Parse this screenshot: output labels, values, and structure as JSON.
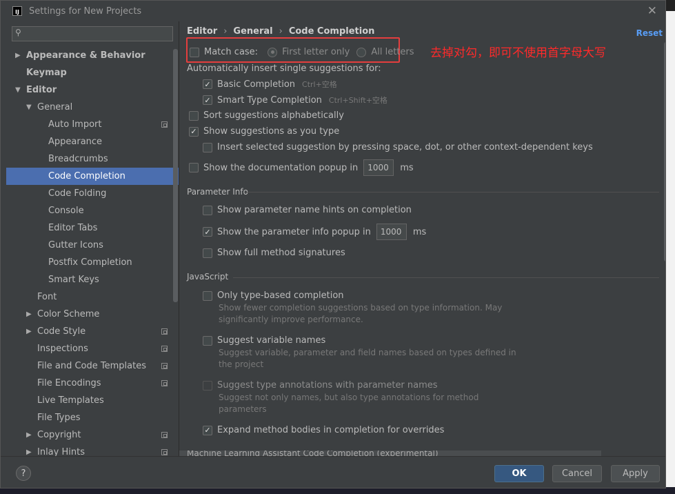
{
  "window": {
    "title": "Settings for New Projects",
    "logo_text": "IJ"
  },
  "search": {
    "placeholder": ""
  },
  "tree": [
    {
      "label": "Appearance & Behavior",
      "bold": true,
      "arrow": "▶",
      "indent": 0
    },
    {
      "label": "Keymap",
      "bold": true,
      "arrow": "",
      "indent": 0
    },
    {
      "label": "Editor",
      "bold": true,
      "arrow": "▼",
      "indent": 0
    },
    {
      "label": "General",
      "bold": false,
      "arrow": "▼",
      "indent": 1
    },
    {
      "label": "Auto Import",
      "bold": false,
      "arrow": "",
      "indent": 2,
      "copy": true
    },
    {
      "label": "Appearance",
      "bold": false,
      "arrow": "",
      "indent": 2
    },
    {
      "label": "Breadcrumbs",
      "bold": false,
      "arrow": "",
      "indent": 2
    },
    {
      "label": "Code Completion",
      "bold": false,
      "arrow": "",
      "indent": 2,
      "selected": true
    },
    {
      "label": "Code Folding",
      "bold": false,
      "arrow": "",
      "indent": 2
    },
    {
      "label": "Console",
      "bold": false,
      "arrow": "",
      "indent": 2
    },
    {
      "label": "Editor Tabs",
      "bold": false,
      "arrow": "",
      "indent": 2
    },
    {
      "label": "Gutter Icons",
      "bold": false,
      "arrow": "",
      "indent": 2
    },
    {
      "label": "Postfix Completion",
      "bold": false,
      "arrow": "",
      "indent": 2
    },
    {
      "label": "Smart Keys",
      "bold": false,
      "arrow": "",
      "indent": 2
    },
    {
      "label": "Font",
      "bold": false,
      "arrow": "",
      "indent": 1
    },
    {
      "label": "Color Scheme",
      "bold": false,
      "arrow": "▶",
      "indent": 1
    },
    {
      "label": "Code Style",
      "bold": false,
      "arrow": "▶",
      "indent": 1,
      "copy": true
    },
    {
      "label": "Inspections",
      "bold": false,
      "arrow": "",
      "indent": 1,
      "copy": true
    },
    {
      "label": "File and Code Templates",
      "bold": false,
      "arrow": "",
      "indent": 1,
      "copy": true
    },
    {
      "label": "File Encodings",
      "bold": false,
      "arrow": "",
      "indent": 1,
      "copy": true
    },
    {
      "label": "Live Templates",
      "bold": false,
      "arrow": "",
      "indent": 1
    },
    {
      "label": "File Types",
      "bold": false,
      "arrow": "",
      "indent": 1
    },
    {
      "label": "Copyright",
      "bold": false,
      "arrow": "▶",
      "indent": 1,
      "copy": true
    },
    {
      "label": "Inlay Hints",
      "bold": false,
      "arrow": "▶",
      "indent": 1,
      "copy": true
    }
  ],
  "breadcrumb": {
    "a": "Editor",
    "sep": "›",
    "b": "General",
    "c": "Code Completion"
  },
  "reset_label": "Reset",
  "annotation": "去掉对勾，即可不使用首字母大写",
  "match_case": {
    "label": "Match case:",
    "checked": false,
    "opt1": "First letter only",
    "opt2": "All letters"
  },
  "auto_insert_label": "Automatically insert single suggestions for:",
  "basic": {
    "label": "Basic Completion",
    "hint": "Ctrl+空格",
    "checked": true
  },
  "smart": {
    "label": "Smart Type Completion",
    "hint": "Ctrl+Shift+空格",
    "checked": true
  },
  "sort_alpha": {
    "label": "Sort suggestions alphabetically",
    "checked": false
  },
  "show_as_type": {
    "label": "Show suggestions as you type",
    "checked": true
  },
  "insert_selected": {
    "label": "Insert selected suggestion by pressing space, dot, or other context-dependent keys",
    "checked": false
  },
  "doc_popup": {
    "label": "Show the documentation popup in",
    "value": "1000",
    "unit": "ms",
    "checked": false
  },
  "param_info": {
    "section": "Parameter Info",
    "name_hints": {
      "label": "Show parameter name hints on completion",
      "checked": false
    },
    "info_popup": {
      "label": "Show the parameter info popup in",
      "value": "1000",
      "unit": "ms",
      "checked": true
    },
    "full_sig": {
      "label": "Show full method signatures",
      "checked": false
    }
  },
  "javascript": {
    "section": "JavaScript",
    "type_based": {
      "label": "Only type-based completion",
      "desc": "Show fewer completion suggestions based on type information. May significantly improve performance.",
      "checked": false
    },
    "var_names": {
      "label": "Suggest variable names",
      "desc": "Suggest variable, parameter and field names based on types defined in the project",
      "checked": false
    },
    "type_annot": {
      "label": "Suggest type annotations with parameter names",
      "desc": "Suggest not only names, but also type annotations for method parameters",
      "checked": false,
      "disabled": true
    },
    "expand_bodies": {
      "label": "Expand method bodies in completion for overrides",
      "checked": true
    }
  },
  "ml_section": "Machine Learning Assistant Code Completion (experimental)",
  "buttons": {
    "help": "?",
    "ok": "OK",
    "cancel": "Cancel",
    "apply": "Apply"
  }
}
